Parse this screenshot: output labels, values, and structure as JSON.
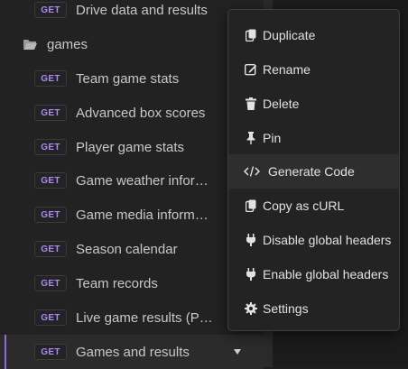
{
  "tree": {
    "items": [
      {
        "method": "GET",
        "label": "Drive data and results"
      },
      {
        "type": "folder",
        "label": "games"
      },
      {
        "method": "GET",
        "label": "Team game stats"
      },
      {
        "method": "GET",
        "label": "Advanced box scores"
      },
      {
        "method": "GET",
        "label": "Player game stats"
      },
      {
        "method": "GET",
        "label": "Game weather information"
      },
      {
        "method": "GET",
        "label": "Game media information"
      },
      {
        "method": "GET",
        "label": "Season calendar"
      },
      {
        "method": "GET",
        "label": "Team records"
      },
      {
        "method": "GET",
        "label": "Live game results (Patreon only)"
      },
      {
        "method": "GET",
        "label": "Games and results",
        "selected": true
      }
    ]
  },
  "context_menu": {
    "items": [
      {
        "label": "Duplicate",
        "icon": "duplicate-icon"
      },
      {
        "label": "Rename",
        "icon": "rename-icon"
      },
      {
        "label": "Delete",
        "icon": "trash-icon"
      },
      {
        "label": "Pin",
        "icon": "pin-icon"
      },
      {
        "label": "Generate Code",
        "icon": "code-icon",
        "hovered": true
      },
      {
        "label": "Copy as cURL",
        "icon": "copy-icon"
      },
      {
        "label": "Disable global headers",
        "icon": "plug-icon"
      },
      {
        "label": "Enable global headers",
        "icon": "plug-icon"
      },
      {
        "label": "Settings",
        "icon": "gear-icon"
      }
    ]
  },
  "colors": {
    "method_get": "#a78bfa",
    "selection_bar": "#8b6fd6",
    "menu_bg": "#232323",
    "menu_hover": "#2e2e2e"
  }
}
